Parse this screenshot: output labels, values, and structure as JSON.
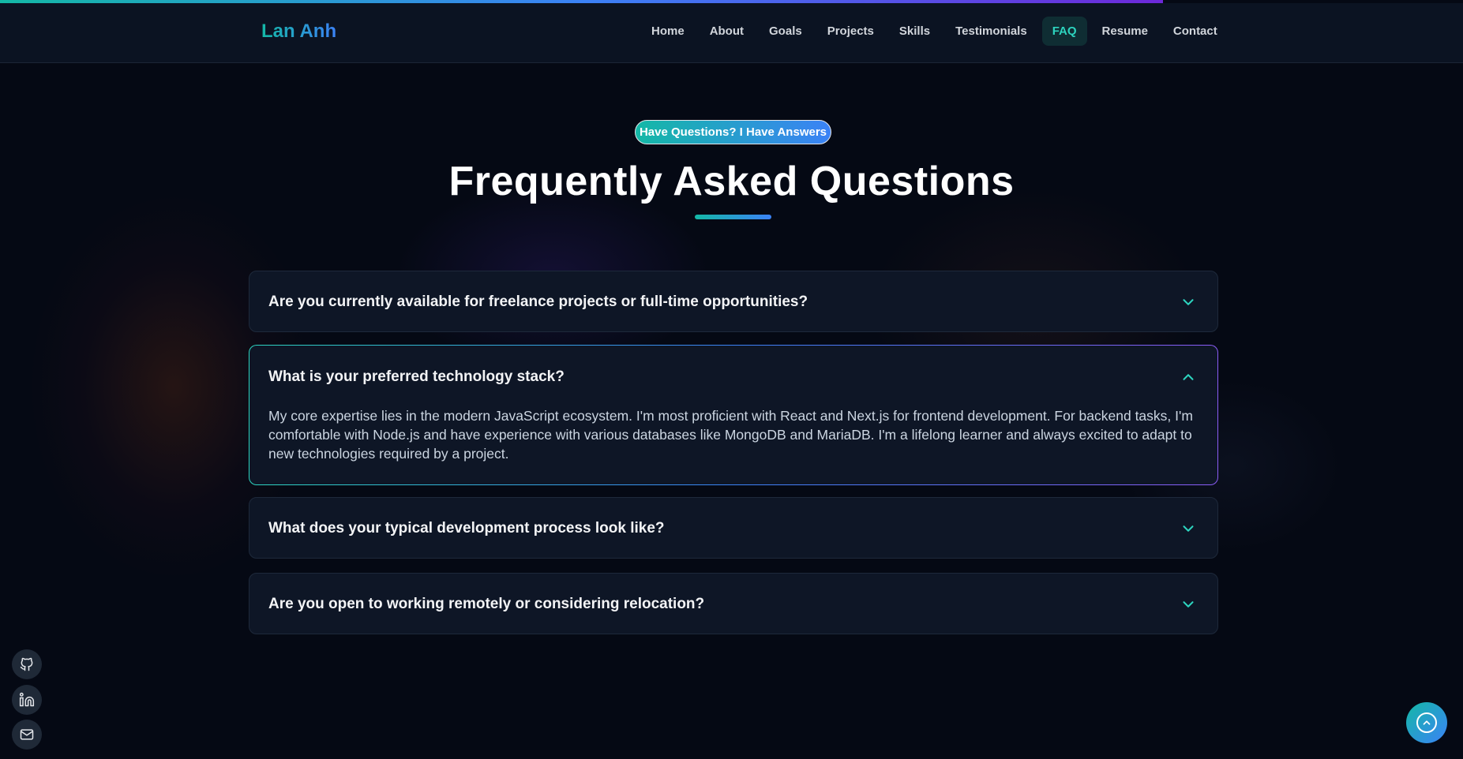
{
  "progress": {
    "percent": 79.5,
    "colors": [
      "#14b8a6",
      "#3b82f6",
      "#6d28d9"
    ]
  },
  "header": {
    "logo": "Lan Anh",
    "nav": [
      {
        "label": "Home",
        "active": false
      },
      {
        "label": "About",
        "active": false
      },
      {
        "label": "Goals",
        "active": false
      },
      {
        "label": "Projects",
        "active": false
      },
      {
        "label": "Skills",
        "active": false
      },
      {
        "label": "Testimonials",
        "active": false
      },
      {
        "label": "FAQ",
        "active": true
      },
      {
        "label": "Resume",
        "active": false
      },
      {
        "label": "Contact",
        "active": false
      }
    ]
  },
  "hero": {
    "badge": "Have Questions? I Have Answers",
    "title": "Frequently Asked Questions"
  },
  "faq": [
    {
      "question": "Are you currently available for freelance projects or full-time opportunities?",
      "open": false,
      "icon": "chevron-down-icon"
    },
    {
      "question": "What is your preferred technology stack?",
      "open": true,
      "icon": "chevron-up-icon",
      "answer": "My core expertise lies in the modern JavaScript ecosystem. I'm most proficient with React and Next.js for frontend development. For backend tasks, I'm comfortable with Node.js and have experience with various databases like MongoDB and MariaDB. I'm a lifelong learner and always excited to adapt to new technologies required by a project."
    },
    {
      "question": "What does your typical development process look like?",
      "open": false,
      "icon": "chevron-down-icon"
    },
    {
      "question": "Are you open to working remotely or considering relocation?",
      "open": false,
      "icon": "chevron-down-icon"
    }
  ],
  "social": [
    {
      "icon": "github-icon"
    },
    {
      "icon": "linkedin-icon"
    },
    {
      "icon": "mail-icon"
    }
  ],
  "scroll_top": {
    "icon": "arrow-up-icon"
  },
  "colors": {
    "accent": "#2dd4bf",
    "accent_blue": "#3b82f6",
    "background": "#050914",
    "card": "#0e1626"
  }
}
